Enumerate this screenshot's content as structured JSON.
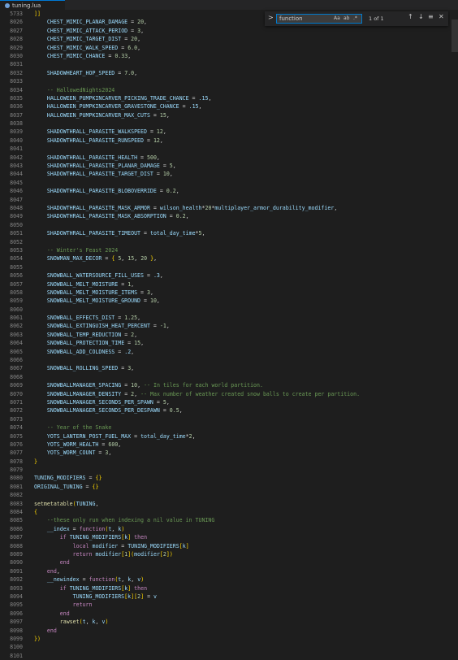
{
  "tab": {
    "filename": "tuning.lua"
  },
  "find": {
    "query": "function",
    "opt_case": "Aa",
    "opt_word": "ab",
    "opt_regex": ".*",
    "result": "1 of 1",
    "up": "↑",
    "down": "↓",
    "menu": "≡",
    "close": "✕",
    "chevron": ">"
  },
  "lines": [
    {
      "n": "5733",
      "t": "]]"
    },
    {
      "n": "8026",
      "t": "    CHEST_MIMIC_PLANAR_DAMAGE = 20,"
    },
    {
      "n": "8027",
      "t": "    CHEST_MIMIC_ATTACK_PERIOD = 3,"
    },
    {
      "n": "8028",
      "t": "    CHEST_MIMIC_TARGET_DIST = 20,"
    },
    {
      "n": "8029",
      "t": "    CHEST_MIMIC_WALK_SPEED = 6.0,"
    },
    {
      "n": "8030",
      "t": "    CHEST_MIMIC_CHANCE = 0.33,"
    },
    {
      "n": "8031",
      "t": ""
    },
    {
      "n": "8032",
      "t": "    SHADOWHEART_HOP_SPEED = 7.0,"
    },
    {
      "n": "8033",
      "t": ""
    },
    {
      "n": "8034",
      "t": "    -- HallowedNights2024"
    },
    {
      "n": "8035",
      "t": "    HALLOWEEN_PUMPKINCARVER_PICKING_TRADE_CHANCE = .15,"
    },
    {
      "n": "8036",
      "t": "    HALLOWEEN_PUMPKINCARVER_GRAVESTONE_CHANCE = .15,"
    },
    {
      "n": "8037",
      "t": "    HALLOWEEN_PUMPKINCARVER_MAX_CUTS = 15,"
    },
    {
      "n": "8038",
      "t": ""
    },
    {
      "n": "8039",
      "t": "    SHADOWTHRALL_PARASITE_WALKSPEED = 12,"
    },
    {
      "n": "8040",
      "t": "    SHADOWTHRALL_PARASITE_RUNSPEED = 12,"
    },
    {
      "n": "8041",
      "t": ""
    },
    {
      "n": "8042",
      "t": "    SHADOWTHRALL_PARASITE_HEALTH = 500,"
    },
    {
      "n": "8043",
      "t": "    SHADOWTHRALL_PARASITE_PLANAR_DAMAGE = 5,"
    },
    {
      "n": "8044",
      "t": "    SHADOWTHRALL_PARASITE_TARGET_DIST = 10,"
    },
    {
      "n": "8045",
      "t": ""
    },
    {
      "n": "8046",
      "t": "    SHADOWTHRALL_PARASITE_BLOBOVERRIDE = 0.2,"
    },
    {
      "n": "8047",
      "t": ""
    },
    {
      "n": "8048",
      "t": "    SHADOWTHRALL_PARASITE_MASK_ARMOR = wilson_health*20*multiplayer_armor_durability_modifier,"
    },
    {
      "n": "8049",
      "t": "    SHADOWTHRALL_PARASITE_MASK_ABSORPTION = 0.2,"
    },
    {
      "n": "8050",
      "t": ""
    },
    {
      "n": "8051",
      "t": "    SHADOWTHRALL_PARASITE_TIMEOUT = total_day_time*5,"
    },
    {
      "n": "8052",
      "t": ""
    },
    {
      "n": "8053",
      "t": "    -- Winter's Feast 2024"
    },
    {
      "n": "8054",
      "t": "    SNOWMAN_MAX_DECOR = { 5, 15, 20 },"
    },
    {
      "n": "8055",
      "t": ""
    },
    {
      "n": "8056",
      "t": "    SNOWBALL_WATERSOURCE_FILL_USES = .3,"
    },
    {
      "n": "8057",
      "t": "    SNOWBALL_MELT_MOISTURE = 1,"
    },
    {
      "n": "8058",
      "t": "    SNOWBALL_MELT_MOISTURE_ITEMS = 3,"
    },
    {
      "n": "8059",
      "t": "    SNOWBALL_MELT_MOISTURE_GROUND = 10,"
    },
    {
      "n": "8060",
      "t": ""
    },
    {
      "n": "8061",
      "t": "    SNOWBALL_EFFECTS_DIST = 1.25,"
    },
    {
      "n": "8062",
      "t": "    SNOWBALL_EXTINGUISH_HEAT_PERCENT = -1,"
    },
    {
      "n": "8063",
      "t": "    SNOWBALL_TEMP_REDUCTION = 2,"
    },
    {
      "n": "8064",
      "t": "    SNOWBALL_PROTECTION_TIME = 15,"
    },
    {
      "n": "8065",
      "t": "    SNOWBALL_ADD_COLDNESS = .2,"
    },
    {
      "n": "8066",
      "t": ""
    },
    {
      "n": "8067",
      "t": "    SNOWBALL_ROLLING_SPEED = 3,"
    },
    {
      "n": "8068",
      "t": ""
    },
    {
      "n": "8069",
      "t": "    SNOWBALLMANAGER_SPACING = 10, -- In tiles for each world partition."
    },
    {
      "n": "8070",
      "t": "    SNOWBALLMANAGER_DENSITY = 2, -- Max number of weather created snow balls to create per partition."
    },
    {
      "n": "8071",
      "t": "    SNOWBALLMANAGER_SECONDS_PER_SPAWN = 5,"
    },
    {
      "n": "8072",
      "t": "    SNOWBALLMANAGER_SECONDS_PER_DESPAWN = 0.5,"
    },
    {
      "n": "8073",
      "t": ""
    },
    {
      "n": "8074",
      "t": "    -- Year of the Snake"
    },
    {
      "n": "8075",
      "t": "    YOTS_LANTERN_POST_FUEL_MAX = total_day_time*2,"
    },
    {
      "n": "8076",
      "t": "    YOTS_WORM_HEALTH = 600,"
    },
    {
      "n": "8077",
      "t": "    YOTS_WORM_COUNT = 3,"
    },
    {
      "n": "8078",
      "t": "}"
    },
    {
      "n": "8079",
      "t": ""
    },
    {
      "n": "8080",
      "t": "TUNING_MODIFIERS = {}"
    },
    {
      "n": "8081",
      "t": "ORIGINAL_TUNING = {}"
    },
    {
      "n": "8082",
      "t": ""
    },
    {
      "n": "8083",
      "t": "setmetatable(TUNING,"
    },
    {
      "n": "8084",
      "t": "{"
    },
    {
      "n": "8085",
      "t": "    --these only run when indexing a nil value in TUNING"
    },
    {
      "n": "8086",
      "t": "    __index = function(t, k)"
    },
    {
      "n": "8087",
      "t": "        if TUNING_MODIFIERS[k] then"
    },
    {
      "n": "8088",
      "t": "            local modifier = TUNING_MODIFIERS[k]"
    },
    {
      "n": "8089",
      "t": "            return modifier[1](modifier[2])"
    },
    {
      "n": "8090",
      "t": "        end"
    },
    {
      "n": "8091",
      "t": "    end,"
    },
    {
      "n": "8092",
      "t": "    __newindex = function(t, k, v)"
    },
    {
      "n": "8093",
      "t": "        if TUNING_MODIFIERS[k] then"
    },
    {
      "n": "8094",
      "t": "            TUNING_MODIFIERS[k][2] = v"
    },
    {
      "n": "8095",
      "t": "            return"
    },
    {
      "n": "8096",
      "t": "        end"
    },
    {
      "n": "8097",
      "t": "        rawset(t, k, v)"
    },
    {
      "n": "8098",
      "t": "    end"
    },
    {
      "n": "8099",
      "t": "})"
    },
    {
      "n": "8100",
      "t": ""
    },
    {
      "n": "8101",
      "t": ""
    }
  ]
}
